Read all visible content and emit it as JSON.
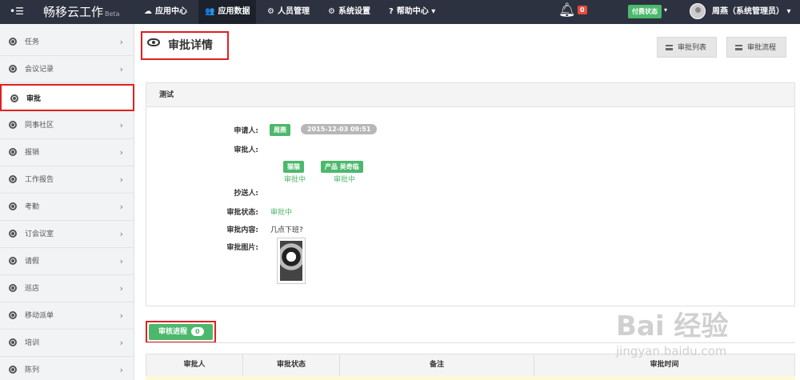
{
  "app": {
    "menu_icon": "menu-icon",
    "brand": "畅移云工作",
    "beta": "Beta"
  },
  "nav": [
    {
      "label": "应用中心",
      "icon": "☁"
    },
    {
      "label": "应用数据",
      "icon": "👥"
    },
    {
      "label": "人员管理",
      "icon": "⚙"
    },
    {
      "label": "系统设置",
      "icon": "⚙"
    },
    {
      "label": "帮助中心",
      "icon": "?",
      "caret": "▾"
    }
  ],
  "notifications": {
    "count": "0"
  },
  "paid_status": {
    "label": "付费状态",
    "caret": "▾"
  },
  "user": {
    "name": "周燕（系统管理员）",
    "caret": "▾"
  },
  "sidebar": {
    "items": [
      {
        "label": "任务"
      },
      {
        "label": "会议记录"
      },
      {
        "label": "审批",
        "active": true
      },
      {
        "label": "同事社区"
      },
      {
        "label": "报销"
      },
      {
        "label": "工作报告"
      },
      {
        "label": "考勤"
      },
      {
        "label": "订会议室"
      },
      {
        "label": "请假"
      },
      {
        "label": "巡店"
      },
      {
        "label": "移动派单"
      },
      {
        "label": "培训"
      },
      {
        "label": "陈列"
      }
    ],
    "chevron": "›"
  },
  "page": {
    "title": "审批详情",
    "buttons": {
      "list": "审批列表",
      "flow": "审批流程"
    }
  },
  "detail": {
    "heading": "测试",
    "applicant_label": "申请人:",
    "applicant": "周燕",
    "applied_at": "2015-12-03 09:51",
    "approver_label": "审批人:",
    "approvers": [
      {
        "name": "猫猫",
        "status": "审批中"
      },
      {
        "name": "产品 吴奇临",
        "status": "审批中"
      }
    ],
    "cc_label": "抄送人:",
    "status_label": "审批状态:",
    "status": "审批中",
    "content_label": "审批内容:",
    "content": "几点下班?",
    "image_label": "审批图片:"
  },
  "progress_tab": {
    "label": "审核进程",
    "count": "0"
  },
  "table": {
    "headers": [
      "审批人",
      "审批状态",
      "备注",
      "审批时间"
    ]
  },
  "watermark": {
    "main": "Bai 经验",
    "sub": "jingyan.baidu.com"
  }
}
